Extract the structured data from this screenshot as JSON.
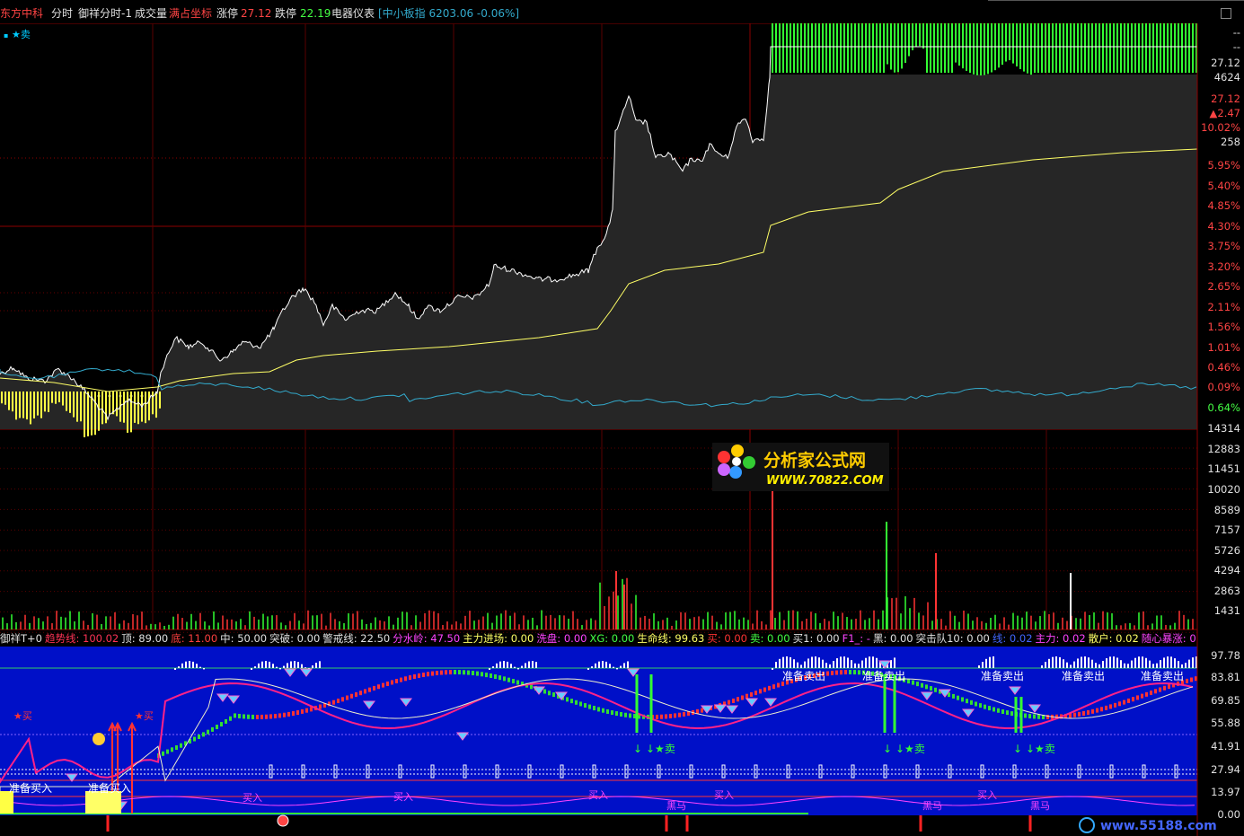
{
  "header": {
    "stock_name": "东方中科",
    "view_mode": "分时",
    "formula_name": "御祥分时-1",
    "volume_label": "成交量",
    "overlay_label": "满占坐标",
    "limit_up_label": "涨停",
    "limit_up_value": "27.12",
    "limit_down_label": "跌停",
    "limit_down_value": "22.19",
    "sector_label": "电器仪表",
    "index_info": "[中小板指 6203.06 -0.06%]"
  },
  "price_panel": {
    "legend": "★卖",
    "price_labels": [
      "27.12",
      "4624",
      "27.12",
      "▲2.47",
      "10.02%",
      "258"
    ],
    "pct_labels": [
      "5.95%",
      "5.40%",
      "4.85%",
      "4.30%",
      "3.75%",
      "3.20%",
      "2.65%",
      "2.11%",
      "1.56%",
      "1.01%",
      "0.46%",
      "0.09%",
      "0.64%"
    ],
    "top_dashes": [
      "--",
      "--"
    ]
  },
  "volume_panel": {
    "labels": [
      "14314",
      "12883",
      "11451",
      "10020",
      "8589",
      "7157",
      "5726",
      "4294",
      "2863",
      "1431"
    ]
  },
  "watermark": {
    "title": "分析家公式网",
    "url": "WWW.70822.COM"
  },
  "indicator_bar": {
    "items": [
      {
        "text": "御祥T+0",
        "color": "#e0e0e0"
      },
      {
        "text": "趋势线: 100.02",
        "color": "#ff3355"
      },
      {
        "text": "顶: 89.00",
        "color": "#e0e0e0"
      },
      {
        "text": "底: 11.00",
        "color": "#ff4040"
      },
      {
        "text": "中: 50.00",
        "color": "#e0e0e0"
      },
      {
        "text": "突破: 0.00",
        "color": "#e0e0e0"
      },
      {
        "text": "警戒线: 22.50",
        "color": "#e0e0e0"
      },
      {
        "text": "分水岭: 47.50",
        "color": "#ff44ff"
      },
      {
        "text": "主力进场: 0.00",
        "color": "#ffff66"
      },
      {
        "text": "洗盘: 0.00",
        "color": "#ff44ff"
      },
      {
        "text": "XG: 0.00",
        "color": "#44ff44"
      },
      {
        "text": "生命线: 99.63",
        "color": "#ffff66"
      },
      {
        "text": "买: 0.00",
        "color": "#ff3333"
      },
      {
        "text": "卖: 0.00",
        "color": "#44ff44"
      },
      {
        "text": "买1: 0.00",
        "color": "#e0e0e0"
      },
      {
        "text": "F1_: -",
        "color": "#ff44ff"
      },
      {
        "text": "黑: 0.00",
        "color": "#e0e0e0"
      },
      {
        "text": "突击队10: 0.00",
        "color": "#e0e0e0"
      },
      {
        "text": "线: 0.02",
        "color": "#4466ff"
      },
      {
        "text": "主力: 0.02",
        "color": "#ff44ff"
      },
      {
        "text": "散户: 0.02",
        "color": "#ffff66"
      },
      {
        "text": "随心暴涨: 0",
        "color": "#ff44ff"
      }
    ]
  },
  "indicator_panel": {
    "labels": [
      "97.78",
      "83.81",
      "69.85",
      "55.88",
      "41.91",
      "27.94",
      "13.97",
      "0.00"
    ],
    "signals": {
      "prepare_sell": "准备卖出",
      "prepare_buy": "准备买入",
      "buy": "★买",
      "sell": "★卖",
      "buy_in": "买入",
      "black_horse": "黑马"
    }
  },
  "footer_watermark": "www.55188.com",
  "colors": {
    "price_line": "#ffffff",
    "avg_line": "#ffff66",
    "index_line": "#33aacc",
    "grid": "#8b0000",
    "up": "#ff3333",
    "down": "#33ff33",
    "panel_bg": "#0010c8"
  }
}
